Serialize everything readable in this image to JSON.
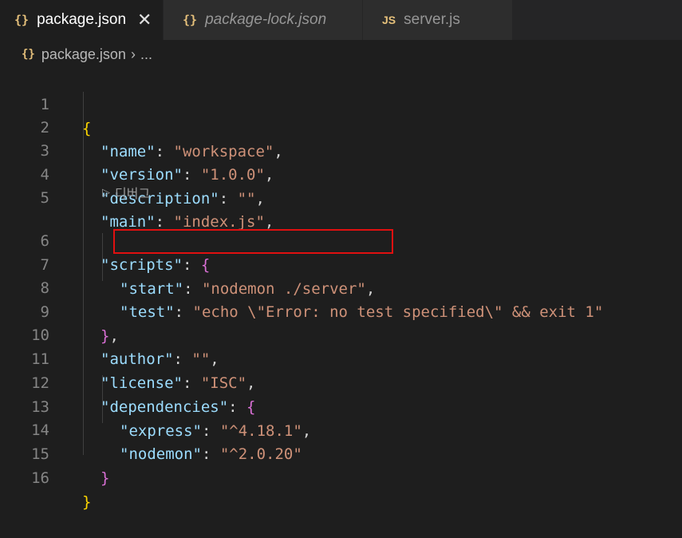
{
  "tabs": [
    {
      "icon": "{}",
      "label": "package.json",
      "close": "✕"
    },
    {
      "icon": "{}",
      "label": "package-lock.json"
    },
    {
      "icon": "JS",
      "label": "server.js"
    }
  ],
  "breadcrumb": {
    "icon": "{}",
    "file": "package.json",
    "sep": "›",
    "rest": "..."
  },
  "codelens": {
    "label": "디버그"
  },
  "lines": [
    {
      "n": "1"
    },
    {
      "n": "2"
    },
    {
      "n": "3"
    },
    {
      "n": "4"
    },
    {
      "n": "5"
    },
    {
      "n": "6"
    },
    {
      "n": "7"
    },
    {
      "n": "8"
    },
    {
      "n": "9"
    },
    {
      "n": "10"
    },
    {
      "n": "11"
    },
    {
      "n": "12"
    },
    {
      "n": "13"
    },
    {
      "n": "14"
    },
    {
      "n": "15"
    },
    {
      "n": "16"
    }
  ],
  "code": {
    "open_brace": "{",
    "name_key": "\"name\"",
    "name_val": "\"workspace\"",
    "version_key": "\"version\"",
    "version_val": "\"1.0.0\"",
    "description_key": "\"description\"",
    "description_val": "\"\"",
    "main_key": "\"main\"",
    "main_val": "\"index.js\"",
    "scripts_key": "\"scripts\"",
    "scripts_open": "{",
    "start_key": "\"start\"",
    "start_val": "\"nodemon ./server\"",
    "test_key": "\"test\"",
    "test_val": "\"echo \\\"Error: no test specified\\\" && exit 1\"",
    "scripts_close": "}",
    "author_key": "\"author\"",
    "author_val": "\"\"",
    "license_key": "\"license\"",
    "license_val": "\"ISC\"",
    "deps_key": "\"dependencies\"",
    "deps_open": "{",
    "express_key": "\"express\"",
    "express_val": "\"^4.18.1\"",
    "nodemon_key": "\"nodemon\"",
    "nodemon_val": "\"^2.0.20\"",
    "deps_close": "}",
    "close_brace": "}"
  }
}
